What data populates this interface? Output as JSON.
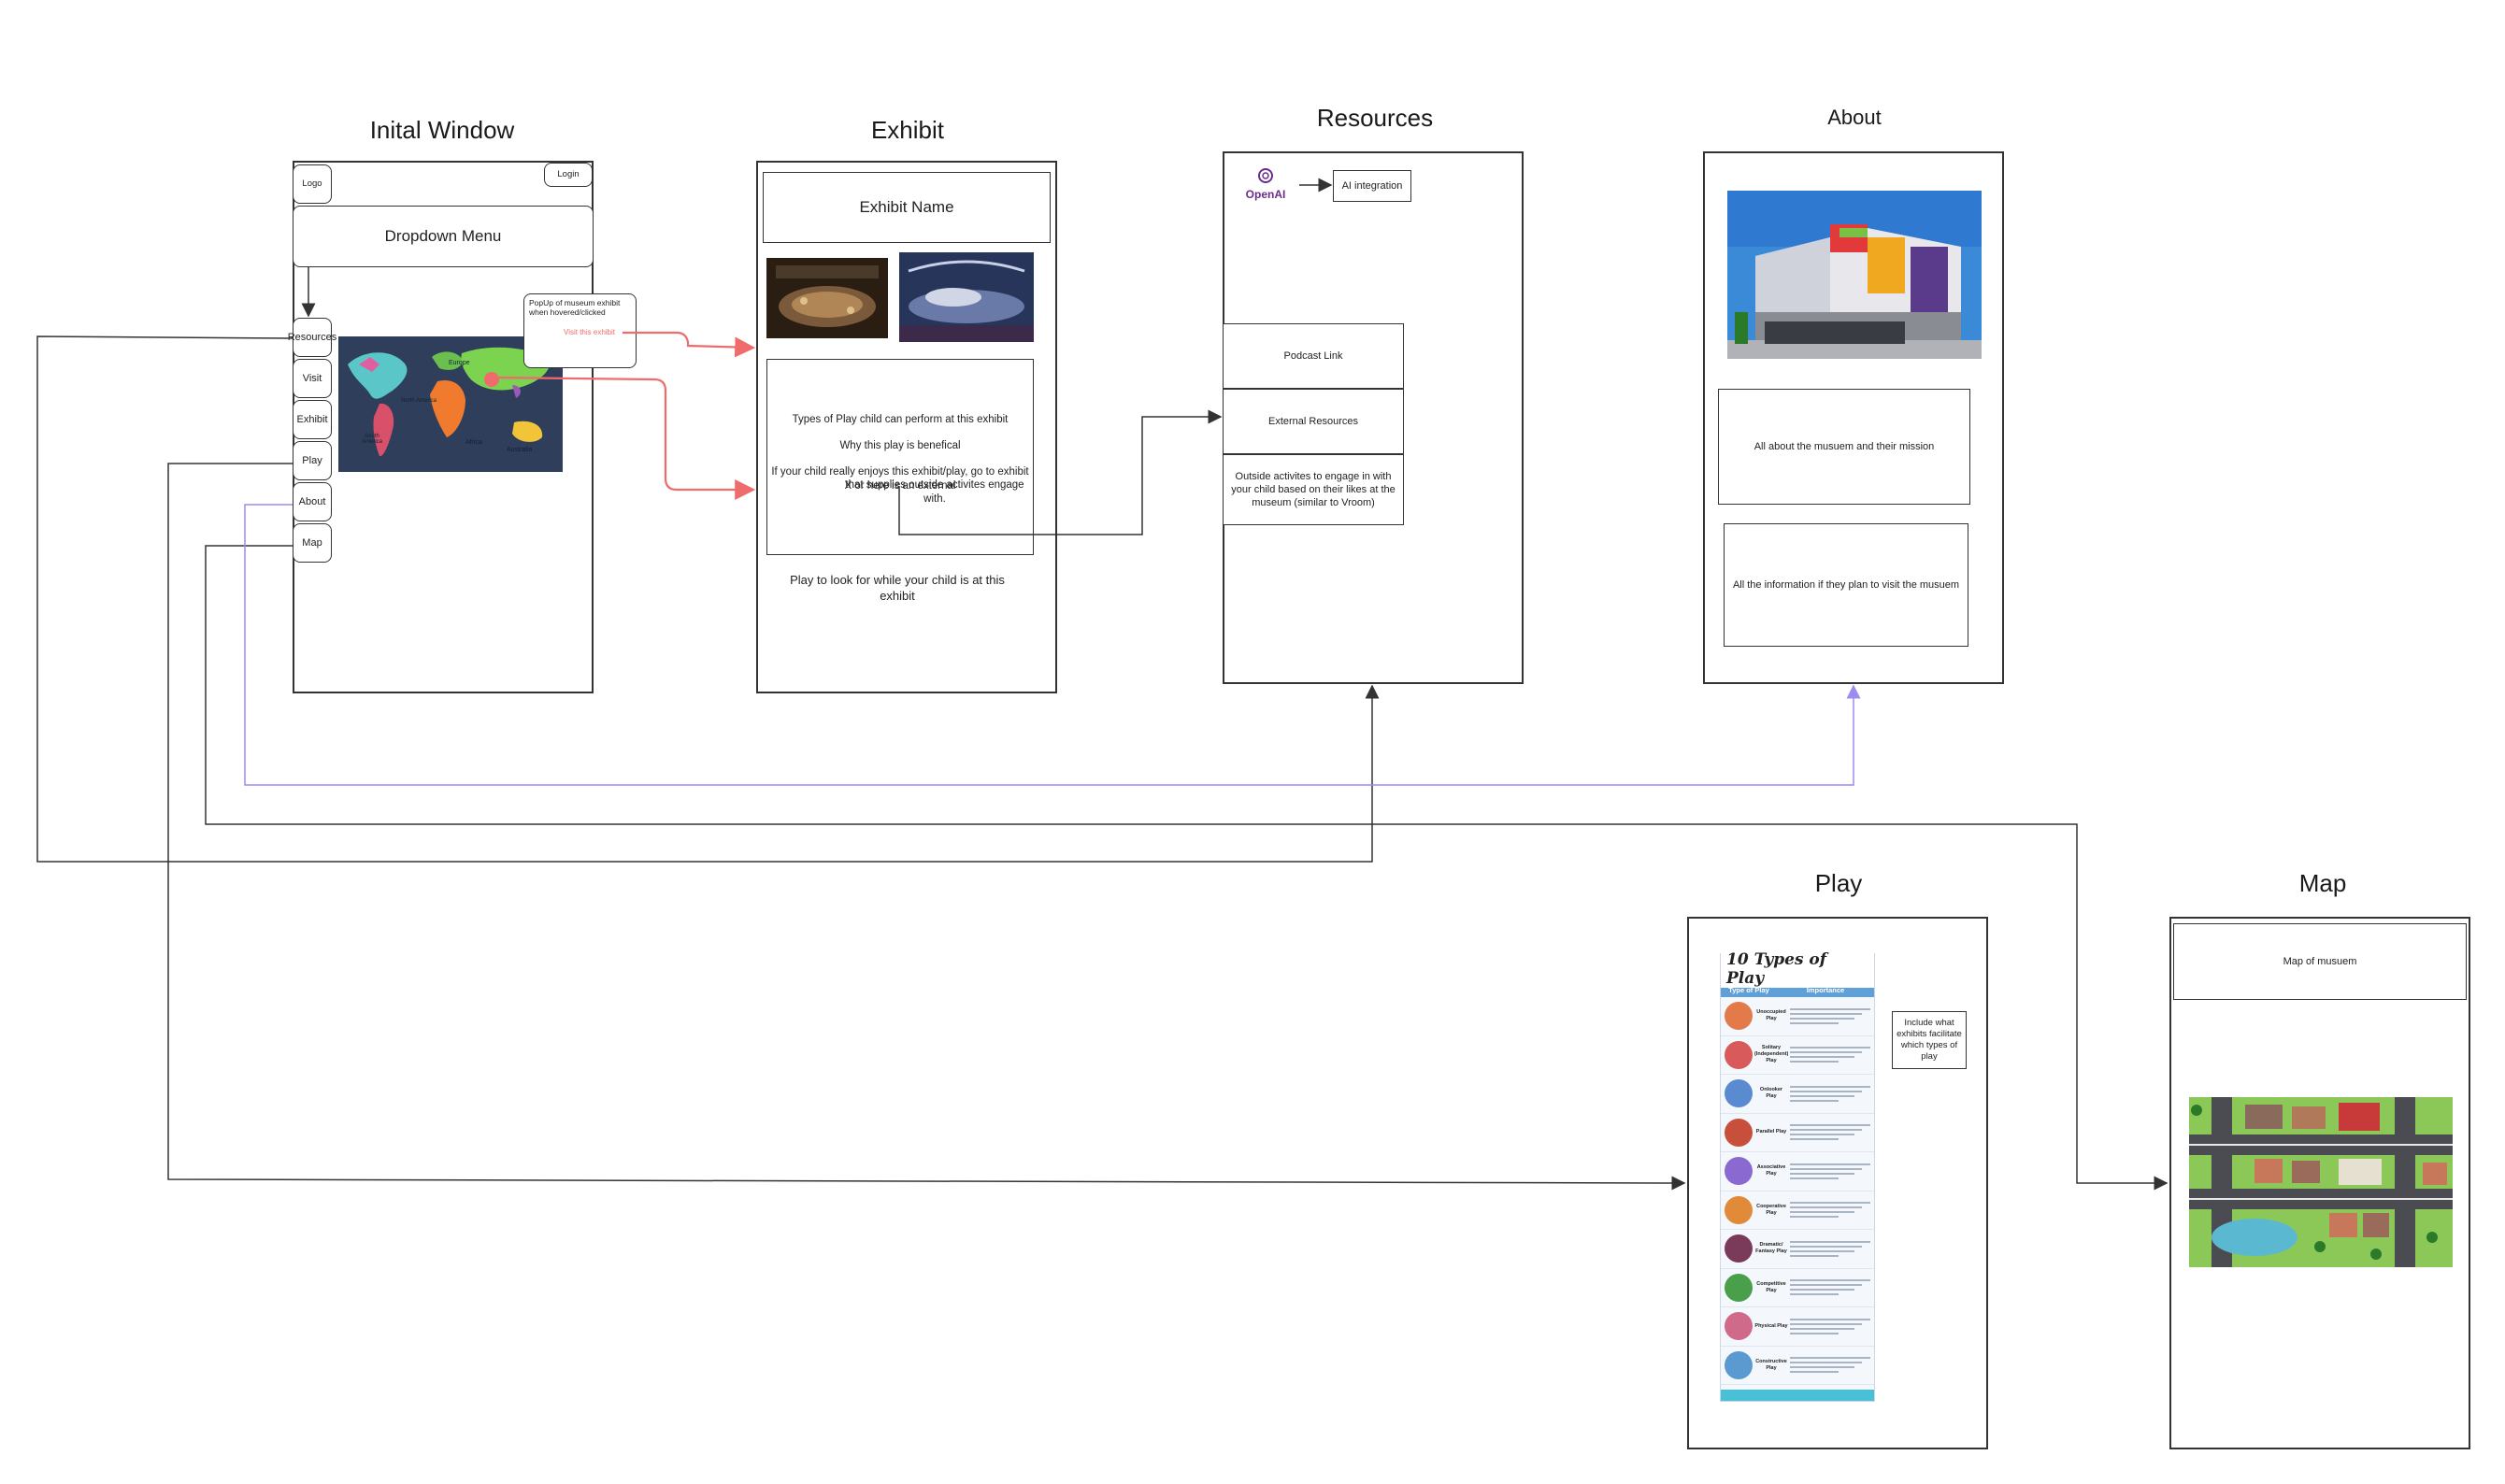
{
  "screens": {
    "initial": {
      "title": "Inital Window",
      "logo": "Logo",
      "login": "Login",
      "dropdown": "Dropdown Menu",
      "nav": [
        "Resources",
        "Visit",
        "Exhibit",
        "Play",
        "About",
        "Map"
      ],
      "popup_text": "PopUp of museum exhibit when hovered/clicked",
      "popup_link": "Visit this exhibit",
      "map_labels": [
        "Europe",
        "North America",
        "South America",
        "Africa",
        "Australia"
      ]
    },
    "exhibit": {
      "title": "Exhibit",
      "name": "Exhibit Name",
      "lines": [
        "Types of Play child can perform at this exhibit",
        "Why this play is benefical",
        "If your child really enjoys this exhibit/play, go to exhibit X or here is an external",
        "that supplies outside activites engage with."
      ],
      "footer": "Play to look for while your child is at this exhibit"
    },
    "resources": {
      "title": "Resources",
      "openai": "OpenAI",
      "ai": "AI integration",
      "podcast": "Podcast Link",
      "external": "External Resources",
      "outside": "Outside activites to engage in with your child based on their likes at the museum (similar to Vroom)"
    },
    "about": {
      "title": "About",
      "mission": "All about the musuem and their mission",
      "visit": "All the information if they plan to visit the musuem"
    },
    "play": {
      "title": "Play",
      "poster_title": "10 Types of Play",
      "col_type": "Type of Play",
      "col_importance": "Importance",
      "types": [
        "Unoccupied Play",
        "Solitary (Independent) Play",
        "Onlooker Play",
        "Parallel Play",
        "Associative Play",
        "Cooperative Play",
        "Dramatic/ Fantasy Play",
        "Competitive Play",
        "Physical Play",
        "Constructive Play"
      ],
      "note": "Include what exhibits facilitate which types of play"
    },
    "map": {
      "title": "Map",
      "header": "Map of musuem"
    }
  },
  "colors": {
    "red_arrow": "#f06b6b",
    "purple_line": "#9b8cf0",
    "dark_line": "#333333"
  }
}
